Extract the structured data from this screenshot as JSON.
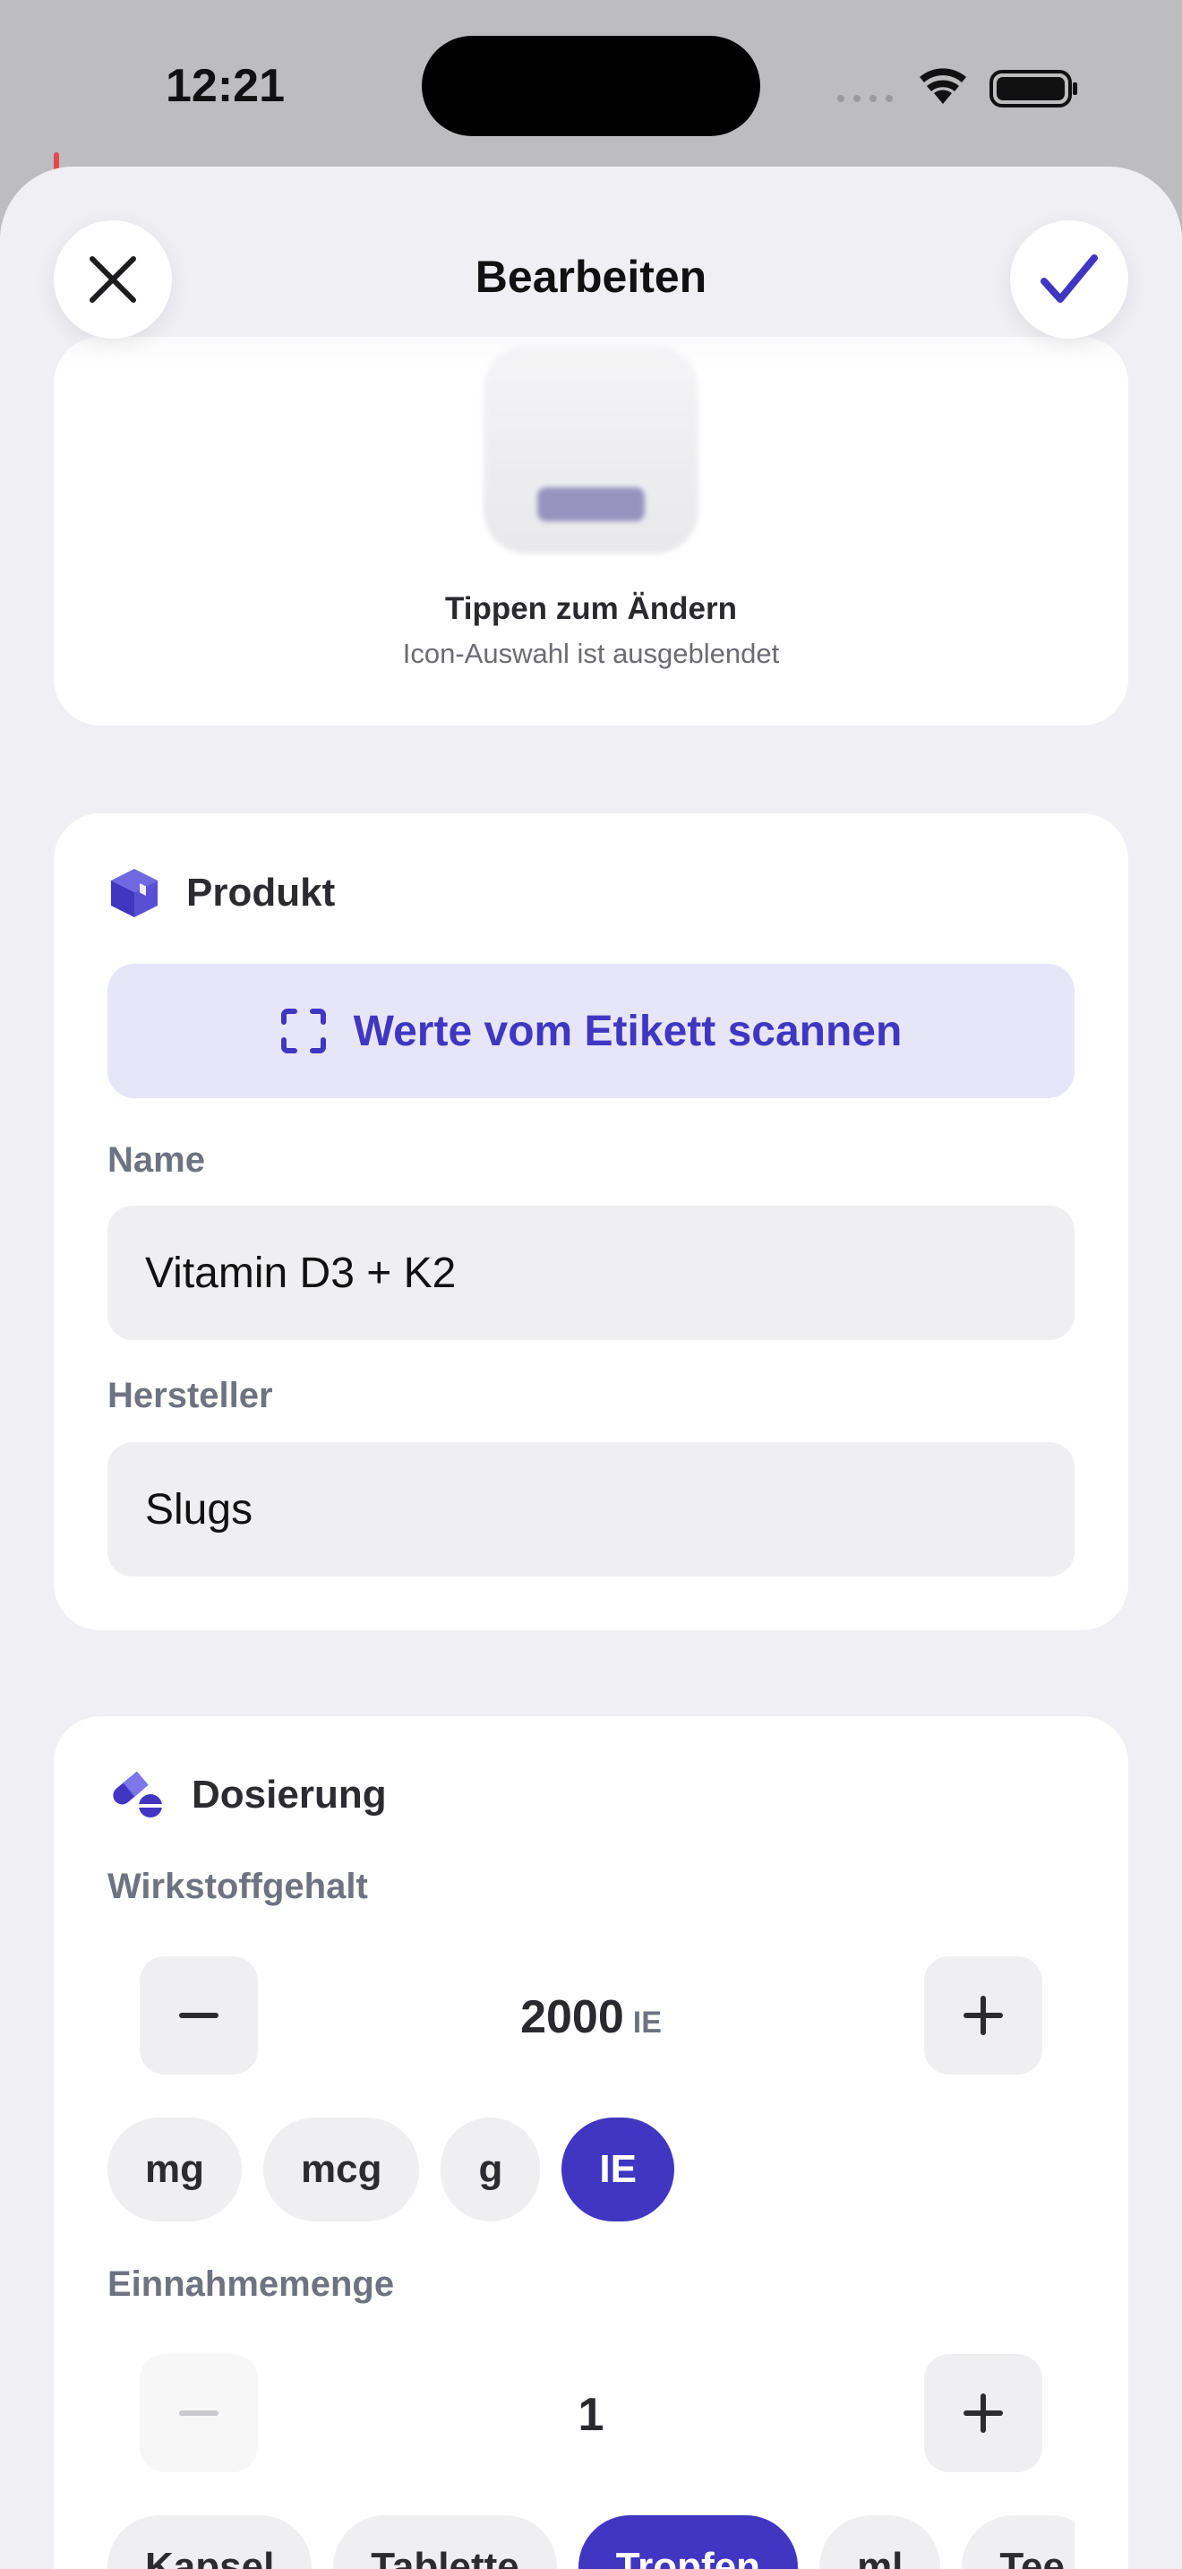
{
  "status_bar": {
    "time": "12:21"
  },
  "header": {
    "title": "Bearbeiten",
    "close_icon": "close-icon",
    "confirm_icon": "checkmark-icon"
  },
  "image_card": {
    "caption": "Tippen zum Ändern",
    "subtitle": "Icon-Auswahl ist ausgeblendet"
  },
  "product": {
    "section_title": "Produkt",
    "section_icon": "box-icon",
    "scan_button_label": "Werte vom Etikett scannen",
    "scan_icon": "scan-frame-icon",
    "name_label": "Name",
    "name_value": "Vitamin D3 + K2",
    "manufacturer_label": "Hersteller",
    "manufacturer_value": "Slugs"
  },
  "dosage": {
    "section_title": "Dosierung",
    "section_icon": "pills-icon",
    "strength_label": "Wirkstoffgehalt",
    "strength_value": "2000",
    "strength_unit": "IE",
    "strength_units": [
      "mg",
      "mcg",
      "g",
      "IE"
    ],
    "strength_selected": "IE",
    "amount_label": "Einnahmemenge",
    "amount_value": "1",
    "amount_units": [
      "Kapsel",
      "Tablette",
      "Tropfen",
      "ml",
      "Tee"
    ],
    "amount_selected": "Tropfen"
  },
  "colors": {
    "accent": "#4036c2",
    "accent_light": "#e7e6f8",
    "sheet_background": "#f0f0f4",
    "card_background": "#ffffff",
    "field_background": "#efeff1"
  }
}
